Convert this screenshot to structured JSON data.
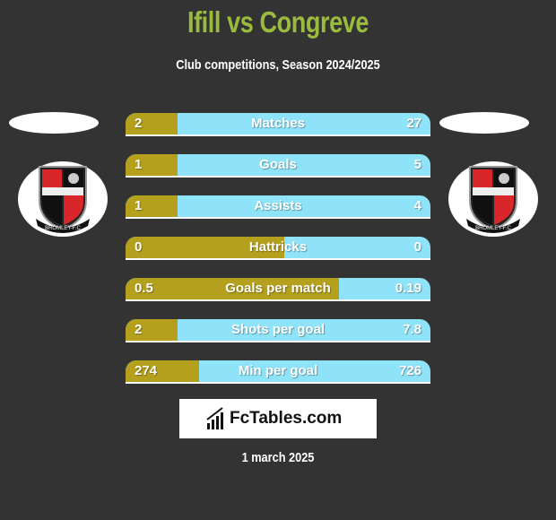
{
  "header": {
    "title": "Ifill vs Congreve",
    "subtitle": "Club competitions, Season 2024/2025"
  },
  "players": {
    "left": {
      "name": "Ifill",
      "club_crest": "bromley-fc-crest",
      "crest_text": "BROMLEY-F.C"
    },
    "right": {
      "name": "Congreve",
      "club_crest": "bromley-fc-crest",
      "crest_text": "BROMLEY-F.C"
    }
  },
  "colors": {
    "left_bar": "#b5a01e",
    "right_bar": "#8fe3f9",
    "title": "#9bbb3e",
    "background": "#333333"
  },
  "chart_data": {
    "type": "bar",
    "title": "Ifill vs Congreve",
    "subtitle": "Club competitions, Season 2024/2025",
    "categories": [
      "Matches",
      "Goals",
      "Assists",
      "Hattricks",
      "Goals per match",
      "Shots per goal",
      "Min per goal"
    ],
    "series": [
      {
        "name": "Ifill",
        "values": [
          2,
          1,
          1,
          0,
          0.5,
          2,
          274
        ],
        "labels": [
          "2",
          "1",
          "1",
          "0",
          "0.5",
          "2",
          "274"
        ]
      },
      {
        "name": "Congreve",
        "values": [
          27,
          5,
          4,
          0,
          0.19,
          7.8,
          726
        ],
        "labels": [
          "27",
          "5",
          "4",
          "0",
          "0.19",
          "7.8",
          "726"
        ]
      }
    ],
    "left_share": [
      0.17,
      0.17,
      0.17,
      0.52,
      0.7,
      0.17,
      0.24
    ]
  },
  "footer": {
    "brand": "FcTables.com",
    "date": "1 march 2025"
  }
}
